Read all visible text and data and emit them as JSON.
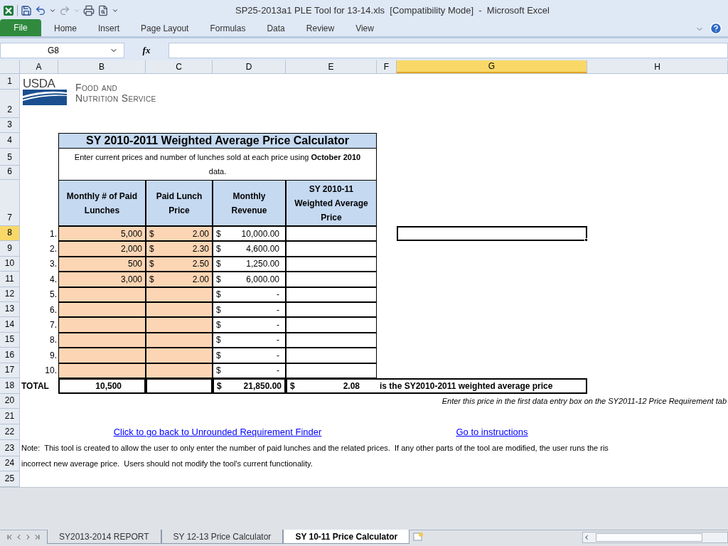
{
  "window": {
    "title": "SP25-2013a1 PLE Tool for 13-14.xls  [Compatibility Mode]  -  Microsoft Excel"
  },
  "ribbon_tabs": [
    {
      "label": "File",
      "kind": "file",
      "selected": false
    },
    {
      "label": "Home",
      "kind": "tab",
      "selected": false
    },
    {
      "label": "Insert",
      "kind": "tab",
      "selected": false
    },
    {
      "label": "Page Layout",
      "kind": "tab",
      "selected": false
    },
    {
      "label": "Formulas",
      "kind": "tab",
      "selected": false
    },
    {
      "label": "Data",
      "kind": "tab",
      "selected": false
    },
    {
      "label": "Review",
      "kind": "tab",
      "selected": false
    },
    {
      "label": "View",
      "kind": "tab",
      "selected": false
    }
  ],
  "formula_bar": {
    "name_box": "G8",
    "fx": "fx"
  },
  "columns": [
    {
      "label": "A",
      "selected": false
    },
    {
      "label": "B",
      "selected": false
    },
    {
      "label": "C",
      "selected": false
    },
    {
      "label": "D",
      "selected": false
    },
    {
      "label": "E",
      "selected": false
    },
    {
      "label": "F",
      "selected": false
    },
    {
      "label": "G",
      "selected": true
    },
    {
      "label": "H",
      "selected": false
    }
  ],
  "row_headers": [
    {
      "label": "1",
      "selected": false
    },
    {
      "label": "2",
      "selected": false
    },
    {
      "label": "3",
      "selected": false
    },
    {
      "label": "4",
      "selected": false
    },
    {
      "label": "5",
      "selected": false
    },
    {
      "label": "6",
      "selected": false
    },
    {
      "label": "7",
      "selected": false
    },
    {
      "label": "8",
      "selected": true
    },
    {
      "label": "9",
      "selected": false
    },
    {
      "label": "10",
      "selected": false
    },
    {
      "label": "11",
      "selected": false
    },
    {
      "label": "12",
      "selected": false
    },
    {
      "label": "13",
      "selected": false
    },
    {
      "label": "14",
      "selected": false
    },
    {
      "label": "15",
      "selected": false
    },
    {
      "label": "16",
      "selected": false
    },
    {
      "label": "17",
      "selected": false
    },
    {
      "label": "18",
      "selected": false
    },
    {
      "label": "20",
      "selected": false
    },
    {
      "label": "21",
      "selected": false
    },
    {
      "label": "22",
      "selected": false
    },
    {
      "label": "23",
      "selected": false
    },
    {
      "label": "24",
      "selected": false
    },
    {
      "label": "25",
      "selected": false
    }
  ],
  "logo": {
    "agency": "USDA",
    "line1": "Food and",
    "line2": "Nutrition Service"
  },
  "calculator": {
    "title": "SY 2010-2011 Weighted Average Price Calculator",
    "instruction": "Enter current prices and number of lunches sold at each price using **October 2010** data.",
    "headers": [
      "Monthly # of Paid Lunches",
      "Paid Lunch Price",
      "Monthly Revenue",
      "SY 2010-11 Weighted Average Price"
    ],
    "rows": [
      {
        "label": "1.",
        "lunches": "5,000",
        "price_currency": "$",
        "price": "2.00",
        "revenue_currency": "$",
        "revenue": "10,000.00"
      },
      {
        "label": "2.",
        "lunches": "2,000",
        "price_currency": "$",
        "price": "2.30",
        "revenue_currency": "$",
        "revenue": "4,600.00"
      },
      {
        "label": "3.",
        "lunches": "500",
        "price_currency": "$",
        "price": "2.50",
        "revenue_currency": "$",
        "revenue": "1,250.00"
      },
      {
        "label": "4.",
        "lunches": "3,000",
        "price_currency": "$",
        "price": "2.00",
        "revenue_currency": "$",
        "revenue": "6,000.00"
      },
      {
        "label": "5.",
        "revenue_currency": "$",
        "revenue": "-"
      },
      {
        "label": "6.",
        "revenue_currency": "$",
        "revenue": "-"
      },
      {
        "label": "7.",
        "revenue_currency": "$",
        "revenue": "-"
      },
      {
        "label": "8.",
        "revenue_currency": "$",
        "revenue": "-"
      },
      {
        "label": "9.",
        "revenue_currency": "$",
        "revenue": "-"
      },
      {
        "label": "10.",
        "revenue_currency": "$",
        "revenue": "-"
      }
    ],
    "total": {
      "label": "TOTAL",
      "lunches": "10,500",
      "revenue_currency": "$",
      "revenue": "21,850.00",
      "average_currency": "$",
      "average": "2.08",
      "statement": "is the SY2010-2011 weighted average price"
    }
  },
  "hint": "Enter this price in the first data entry box on the SY2011-12 Price Requirement tab",
  "links": [
    "Click to go back to Unrounded Requirement Finder",
    "Go to instructions"
  ],
  "note": [
    "Note:  This tool is created to allow the user to only enter the number of paid lunches and the related prices.  If any other parts of the tool are modified, the user runs the ris",
    "incorrect new average price.  Users should not modify the tool's current functionality."
  ],
  "sheet_tabs": [
    {
      "label": "SY2013-2014 REPORT",
      "selected": false
    },
    {
      "label": "SY 12-13 Price Calculator",
      "selected": false
    },
    {
      "label": "SY 10-11 Price Calculator",
      "selected": true
    }
  ]
}
